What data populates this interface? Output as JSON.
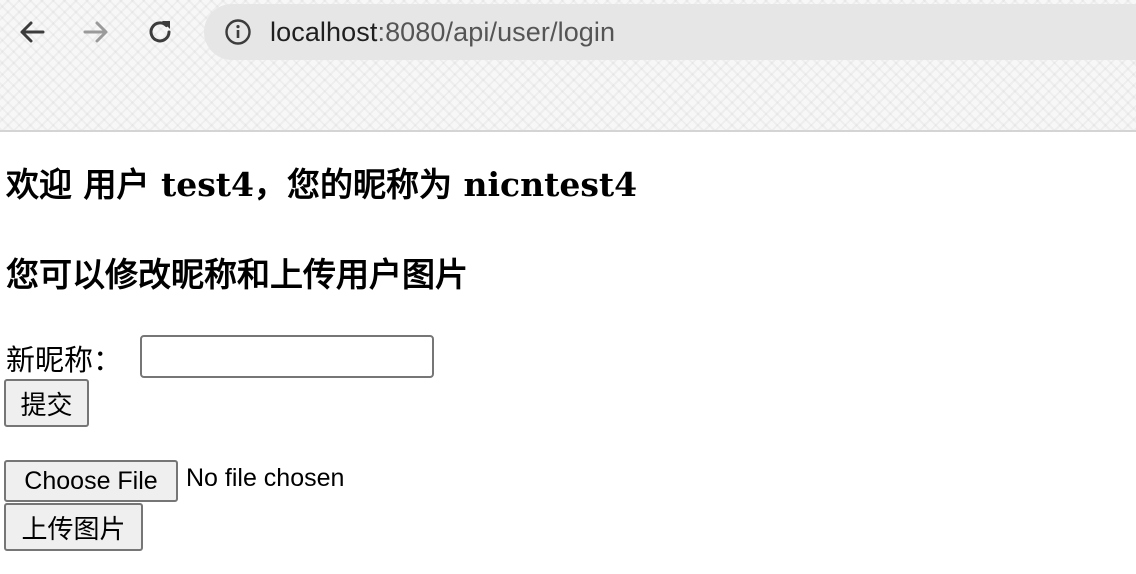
{
  "browser": {
    "back_icon": "arrow-left-icon",
    "forward_icon": "arrow-right-icon",
    "reload_icon": "reload-icon",
    "info_icon": "info-icon",
    "url_host": "localhost",
    "url_rest": ":8080/api/user/login"
  },
  "page": {
    "welcome_text": "欢迎 用户 test4，您的昵称为 nicntest4",
    "subtitle": "您可以修改昵称和上传用户图片",
    "nickname_label": "新昵称：",
    "nickname_value": "",
    "submit_label": "提交",
    "choose_file_label": "Choose File",
    "file_status": "No file chosen",
    "upload_label": "上传图片"
  },
  "colors": {
    "address_bar_bg": "#e6e6e6",
    "button_bg": "#efefef",
    "button_border": "#767676"
  }
}
